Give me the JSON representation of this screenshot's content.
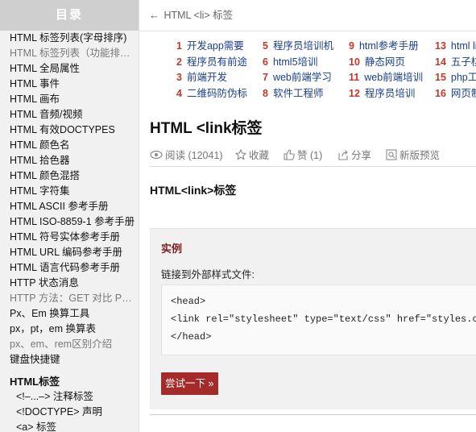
{
  "sidebar": {
    "heading": "目录",
    "items": [
      {
        "label": "HTML 标签列表(字母排序)",
        "muted": false
      },
      {
        "label": "HTML 标签列表（功能排序）",
        "muted": true
      },
      {
        "label": "HTML 全局属性",
        "muted": false
      },
      {
        "label": "HTML 事件",
        "muted": false
      },
      {
        "label": "HTML 画布",
        "muted": false
      },
      {
        "label": "HTML 音频/视频",
        "muted": false
      },
      {
        "label": "HTML 有效DOCTYPES",
        "muted": false
      },
      {
        "label": "HTML 颜色名",
        "muted": false
      },
      {
        "label": "HTML 拾色器",
        "muted": false
      },
      {
        "label": "HTML 颜色混搭",
        "muted": false
      },
      {
        "label": "HTML 字符集",
        "muted": false
      },
      {
        "label": "HTML ASCII 参考手册",
        "muted": false
      },
      {
        "label": "HTML ISO-8859-1 参考手册",
        "muted": false
      },
      {
        "label": "HTML 符号实体参考手册",
        "muted": false
      },
      {
        "label": "HTML URL 编码参考手册",
        "muted": false
      },
      {
        "label": "HTML 语言代码参考手册",
        "muted": false
      },
      {
        "label": "HTTP 状态消息",
        "muted": false
      },
      {
        "label": "HTTP 方法：GET 对比 POST",
        "muted": true
      },
      {
        "label": "Px、Em 换算工具",
        "muted": false
      },
      {
        "label": "px，pt，em 换算表",
        "muted": false
      },
      {
        "label": "px、em、rem区别介绍",
        "muted": true
      },
      {
        "label": "键盘快捷键",
        "muted": false
      }
    ],
    "section_title": "HTML标签",
    "section_items": [
      {
        "label": "<!–...–> 注释标签"
      },
      {
        "label": "<!DOCTYPE> 声明"
      },
      {
        "label": "<a> 标签"
      }
    ]
  },
  "breadcrumb": {
    "back_arrow": "←",
    "text": "HTML <li> 标签"
  },
  "ads": [
    [
      {
        "num": "1",
        "text": "开发app需要"
      },
      {
        "num": "2",
        "text": "程序员有前途"
      },
      {
        "num": "3",
        "text": "前端开发"
      },
      {
        "num": "4",
        "text": "二维码防伪标"
      }
    ],
    [
      {
        "num": "5",
        "text": "程序员培训机"
      },
      {
        "num": "6",
        "text": "html5培训"
      },
      {
        "num": "7",
        "text": "web前端学习"
      },
      {
        "num": "8",
        "text": "软件工程师"
      }
    ],
    [
      {
        "num": "9",
        "text": "html参考手册"
      },
      {
        "num": "10",
        "text": "静态网页"
      },
      {
        "num": "11",
        "text": "web前端培训"
      },
      {
        "num": "12",
        "text": "程序员培训"
      }
    ],
    [
      {
        "num": "13",
        "text": "html lin"
      },
      {
        "num": "14",
        "text": "五子棋"
      },
      {
        "num": "15",
        "text": "php工"
      },
      {
        "num": "16",
        "text": "网页制"
      }
    ]
  ],
  "page": {
    "title": "HTML <link标签",
    "meta": {
      "read": "阅读 (12041)",
      "favorite": "收藏",
      "like": "赞 (1)",
      "share": "分享",
      "preview": "新版预览"
    },
    "subtitle": "HTML<link>标签"
  },
  "example": {
    "label": "实例",
    "description": "链接到外部样式文件:",
    "code_lines": [
      "<head>",
      "<link rel=\"stylesheet\" type=\"text/css\" href=\"styles.css\">",
      "</head>"
    ],
    "try_button": "尝试一下 »"
  },
  "colors": {
    "accent": "#a52a2a",
    "link": "#1a3e8c",
    "ad_number": "#c0392b"
  }
}
